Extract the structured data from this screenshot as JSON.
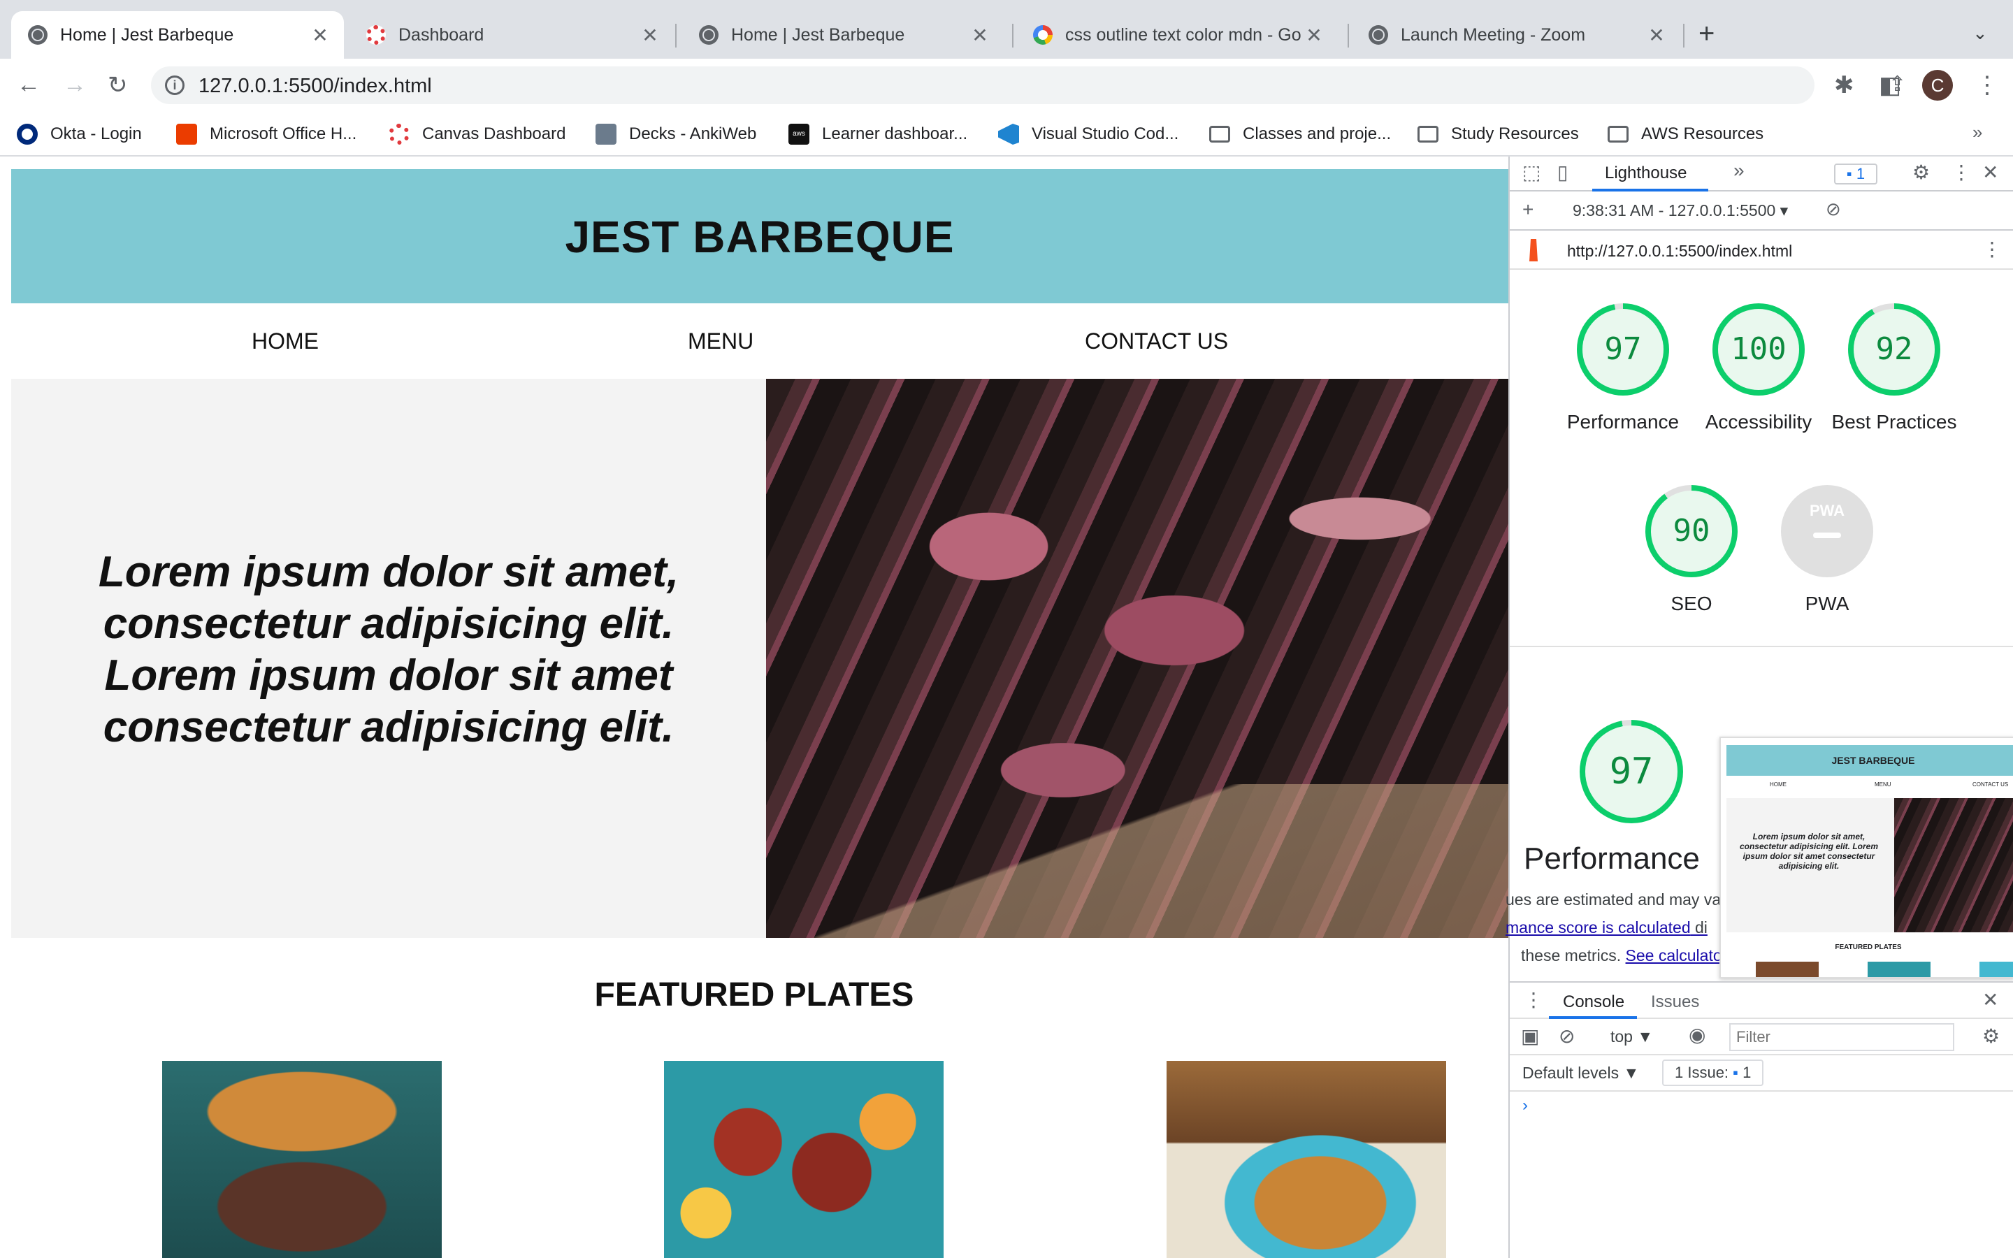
{
  "browser": {
    "tabs": [
      {
        "title": "Home | Jest Barbeque",
        "icon": "globe-icon",
        "active": true
      },
      {
        "title": "Dashboard",
        "icon": "canvas-icon",
        "active": false
      },
      {
        "title": "Home | Jest Barbeque",
        "icon": "globe-icon",
        "active": false
      },
      {
        "title": "css outline text color mdn - Go",
        "icon": "google-icon",
        "active": false
      },
      {
        "title": "Launch Meeting - Zoom",
        "icon": "globe-icon",
        "active": false
      }
    ],
    "tab_close_glyph": "✕",
    "new_tab_glyph": "+",
    "tab_search_glyph": "⌄",
    "url": "127.0.0.1:5500/index.html",
    "avatar_letter": "C",
    "bookmarks": [
      {
        "label": "Okta - Login",
        "icon": "okta-icon"
      },
      {
        "label": "Microsoft Office H...",
        "icon": "office-icon"
      },
      {
        "label": "Canvas Dashboard",
        "icon": "canvas-icon"
      },
      {
        "label": "Decks - AnkiWeb",
        "icon": "anki-icon"
      },
      {
        "label": "Learner dashboar...",
        "icon": "aws-icon"
      },
      {
        "label": "Visual Studio Cod...",
        "icon": "vscode-icon"
      },
      {
        "label": "Classes and proje...",
        "icon": "folder-icon"
      },
      {
        "label": "Study Resources",
        "icon": "folder-icon"
      },
      {
        "label": "AWS Resources",
        "icon": "folder-icon"
      }
    ],
    "bookmarks_more": "»",
    "aws_icon_text": "aws"
  },
  "site": {
    "title": "JEST BARBEQUE",
    "nav": [
      "HOME",
      "MENU",
      "CONTACT US"
    ],
    "hero_text": "Lorem ipsum dolor sit amet, consectetur adipisicing elit. Lorem ipsum dolor sit amet consectetur adipisicing elit.",
    "featured_title": "FEATURED PLATES"
  },
  "devtools": {
    "active_tab": "Lighthouse",
    "more_tabs": "»",
    "issues_badge": "1",
    "report_time": "9:38:31 AM - 127.0.0.1:5500",
    "report_url": "http://127.0.0.1:5500/index.html",
    "scores": [
      {
        "label": "Performance",
        "value": 97,
        "color": "#0cce6b"
      },
      {
        "label": "Accessibility",
        "value": 100,
        "color": "#0cce6b"
      },
      {
        "label": "Best Practices",
        "value": 92,
        "color": "#0cce6b"
      },
      {
        "label": "SEO",
        "value": 90,
        "color": "#0cce6b"
      },
      {
        "label": "PWA",
        "value": null,
        "color": "#e0e0e0"
      }
    ],
    "pwa_badge_text": "PWA",
    "performance_detail": {
      "score": "97",
      "title": "Performance",
      "note_1": "ues are estimated and may va",
      "note_2_link": "mance score is calculated",
      "note_2_rest": " di",
      "note_3": "these metrics. ",
      "note_3_link": "See calculato"
    },
    "thumbnail": {
      "title": "JEST BARBEQUE",
      "nav": [
        "HOME",
        "MENU",
        "CONTACT US"
      ],
      "hero_text": "Lorem ipsum dolor sit amet, consectetur adipisicing elit. Lorem ipsum dolor sit amet consectetur adipisicing elit.",
      "featured": "FEATURED PLATES"
    },
    "drawer": {
      "tabs": [
        "Console",
        "Issues"
      ],
      "context": "top ▼",
      "filter_placeholder": "Filter",
      "levels": "Default levels ▼",
      "issue_counter": "1 Issue:",
      "issue_count": "1",
      "prompt": "›"
    }
  }
}
